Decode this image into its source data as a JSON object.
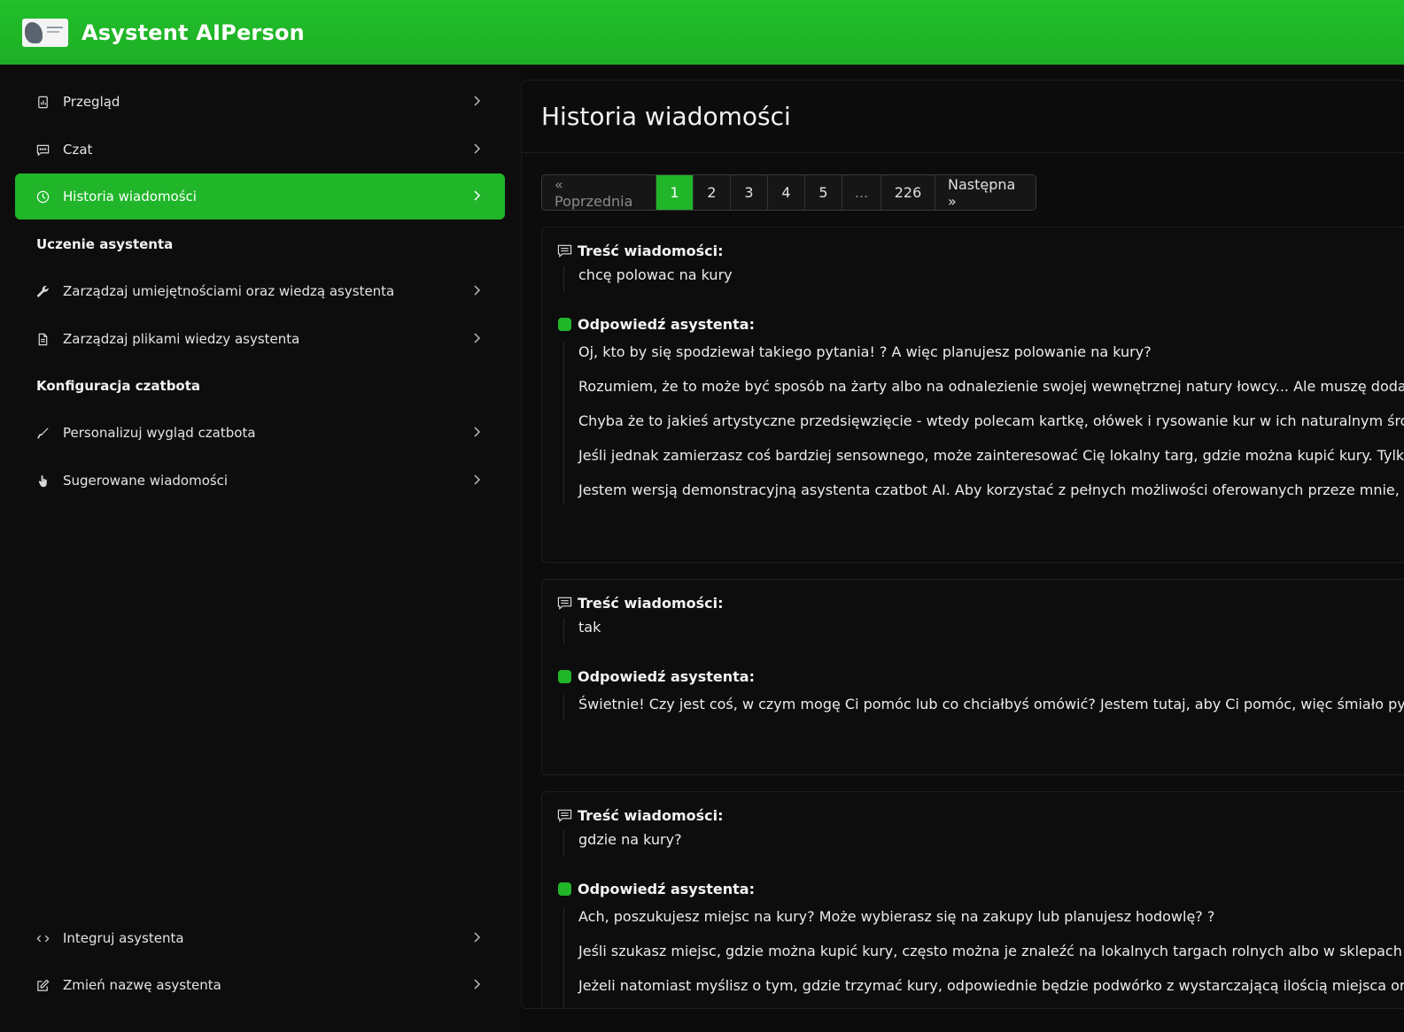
{
  "app": {
    "title": "Asystent AIPerson"
  },
  "sidebar": {
    "items_top": [
      {
        "label": "Przegląd",
        "icon": "document-chart-icon"
      },
      {
        "label": "Czat",
        "icon": "chat-icon"
      },
      {
        "label": "Historia wiadomości",
        "icon": "clock-icon",
        "active": true
      }
    ],
    "section_training": "Uczenie asystenta",
    "items_training": [
      {
        "label": "Zarządzaj umiejętnościami oraz wiedzą asystenta",
        "icon": "wrench-icon"
      },
      {
        "label": "Zarządzaj plikami wiedzy asystenta",
        "icon": "file-icon"
      }
    ],
    "section_config": "Konfiguracja czatbota",
    "items_config": [
      {
        "label": "Personalizuj wygląd czatbota",
        "icon": "brush-icon"
      },
      {
        "label": "Sugerowane wiadomości",
        "icon": "hand-icon"
      }
    ],
    "items_bottom": [
      {
        "label": "Integruj asystenta",
        "icon": "code-icon"
      },
      {
        "label": "Zmień nazwę asystenta",
        "icon": "edit-icon"
      }
    ]
  },
  "main": {
    "title": "Historia wiadomości",
    "pagination": {
      "prev": "« Poprzednia",
      "pages": [
        "1",
        "2",
        "3",
        "4",
        "5",
        "...",
        "226"
      ],
      "current": "1",
      "next": "Następna »"
    },
    "message_label": "Treść wiadomości:",
    "answer_label": "Odpowiedź asystenta:",
    "messages": [
      {
        "question": "chcę polowac na kury",
        "answer": [
          "Oj, kto by się spodziewał takiego pytania! ? A więc planujesz polowanie na kury?",
          "Rozumiem, że to może być sposób na żarty albo na odnalezienie swojej wewnętrznej natury łowcy... Ale muszę dodać, że kury",
          "Chyba że to jakieś artystyczne przedsięwzięcie - wtedy polecam kartkę, ołówek i rysowanie kur w ich naturalnym środowisku!",
          "Jeśli jednak zamierzasz coś bardziej sensownego, może zainteresować Cię lokalny targ, gdzie można kupić kury. Tylko nie zap",
          "Jestem wersją demonstracyjną asystenta czatbot AI. Aby korzystać z pełnych możliwości oferowanych przeze mnie, zapraszam"
        ]
      },
      {
        "question": "tak",
        "answer": [
          "Świetnie! Czy jest coś, w czym mogę Ci pomóc lub co chciałbyś omówić? Jestem tutaj, aby Ci pomóc, więc śmiało pytaj!"
        ]
      },
      {
        "question": "gdzie na kury?",
        "answer": [
          "Ach, poszukujesz miejsc na kury? Może wybierasz się na zakupy lub planujesz hodowlę? ?",
          "Jeśli szukasz miejsc, gdzie można kupić kury, często można je znaleźć na lokalnych targach rolnych albo w sklepach zoologicz",
          "Jeżeli natomiast myślisz o tym, gdzie trzymać kury, odpowiednie będzie podwórko z wystarczającą ilością miejsca oraz zadasz"
        ]
      }
    ]
  }
}
